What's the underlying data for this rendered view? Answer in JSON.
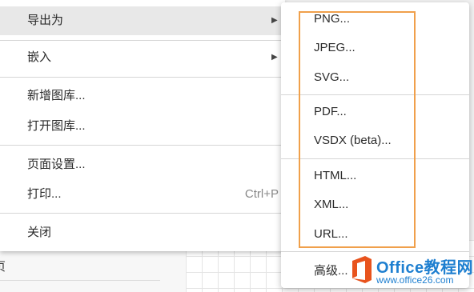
{
  "background": {
    "panel_text": "页"
  },
  "menu": {
    "items": [
      {
        "label": "导出为",
        "has_submenu": true
      },
      {
        "label": "嵌入",
        "has_submenu": true
      },
      {
        "label": "新增图库..."
      },
      {
        "label": "打开图库..."
      },
      {
        "label": "页面设置..."
      },
      {
        "label": "打印...",
        "shortcut": "Ctrl+P"
      },
      {
        "label": "关闭"
      }
    ],
    "arrow_glyph": "▶"
  },
  "submenu": {
    "items": [
      {
        "label": "PNG..."
      },
      {
        "label": "JPEG..."
      },
      {
        "label": "SVG..."
      },
      {
        "label": "PDF..."
      },
      {
        "label": "VSDX (beta)..."
      },
      {
        "label": "HTML..."
      },
      {
        "label": "XML..."
      },
      {
        "label": "URL..."
      },
      {
        "label": "高级..."
      }
    ]
  },
  "watermark": {
    "title": "Office教程网",
    "url": "www.office26.com"
  },
  "colors": {
    "highlight_border": "#f0a04b",
    "hover_bg": "#e8e8e8",
    "watermark_blue": "#1e7fd0",
    "logo_orange": "#e8531d"
  }
}
